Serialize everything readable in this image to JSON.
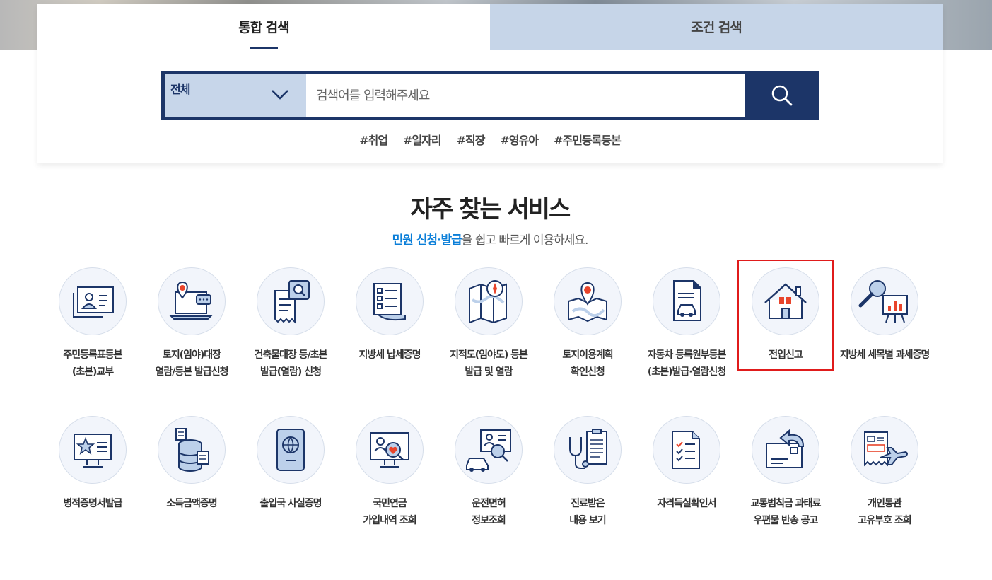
{
  "search": {
    "tabs": [
      {
        "label": "통합 검색",
        "active": true
      },
      {
        "label": "조건 검색",
        "active": false
      }
    ],
    "category_selected": "전체",
    "placeholder": "검색어를 입력해주세요",
    "tags": [
      "#취업",
      "#일자리",
      "#직장",
      "#영유아",
      "#주민등록등본"
    ]
  },
  "section": {
    "title": "자주 찾는 서비스",
    "subtitle_highlight": "민원 신청·발급",
    "subtitle_rest": "을 쉽고 빠르게 이용하세요."
  },
  "services": [
    {
      "label": "주민등록표등본\n(초본)교부",
      "icon": "id-card-icon"
    },
    {
      "label": "토지(임야)대장\n열람/등본 발급신청",
      "icon": "laptop-location-icon"
    },
    {
      "label": "건축물대장 등/초본\n발급(열람) 신청",
      "icon": "document-search-icon"
    },
    {
      "label": "지방세 납세증명",
      "icon": "checklist-scroll-icon"
    },
    {
      "label": "지적도(임야도) 등본\n발급 및 열람",
      "icon": "map-compass-icon"
    },
    {
      "label": "토지이용계획\n확인신청",
      "icon": "map-pin-icon"
    },
    {
      "label": "자동차 등록원부등본\n(초본)발급·열람신청",
      "icon": "car-document-icon"
    },
    {
      "label": "전입신고",
      "icon": "house-icon",
      "highlighted": true
    },
    {
      "label": "지방세 세목별 과세증명",
      "icon": "magnifier-chart-icon"
    },
    {
      "label": "병적증명서발급",
      "icon": "monitor-star-icon"
    },
    {
      "label": "소득금액증명",
      "icon": "database-coins-icon"
    },
    {
      "label": "출입국 사실증명",
      "icon": "passport-icon"
    },
    {
      "label": "국민연금\n가입내역 조회",
      "icon": "pension-heart-icon"
    },
    {
      "label": "운전면허\n정보조회",
      "icon": "driver-license-icon"
    },
    {
      "label": "진료받은\n내용 보기",
      "icon": "stethoscope-clipboard-icon"
    },
    {
      "label": "자격득실확인서",
      "icon": "checklist-icon"
    },
    {
      "label": "교통범칙금 과태료\n우편물 반송 공고",
      "icon": "returned-mail-icon"
    },
    {
      "label": "개인통관\n고유부호 조회",
      "icon": "customs-plane-icon"
    }
  ],
  "colors": {
    "navy": "#1c3568",
    "light_blue": "#c6d5e8",
    "accent_blue": "#0a7ed8",
    "icon_red": "#e8442b",
    "highlight_red": "#e01b1b"
  }
}
